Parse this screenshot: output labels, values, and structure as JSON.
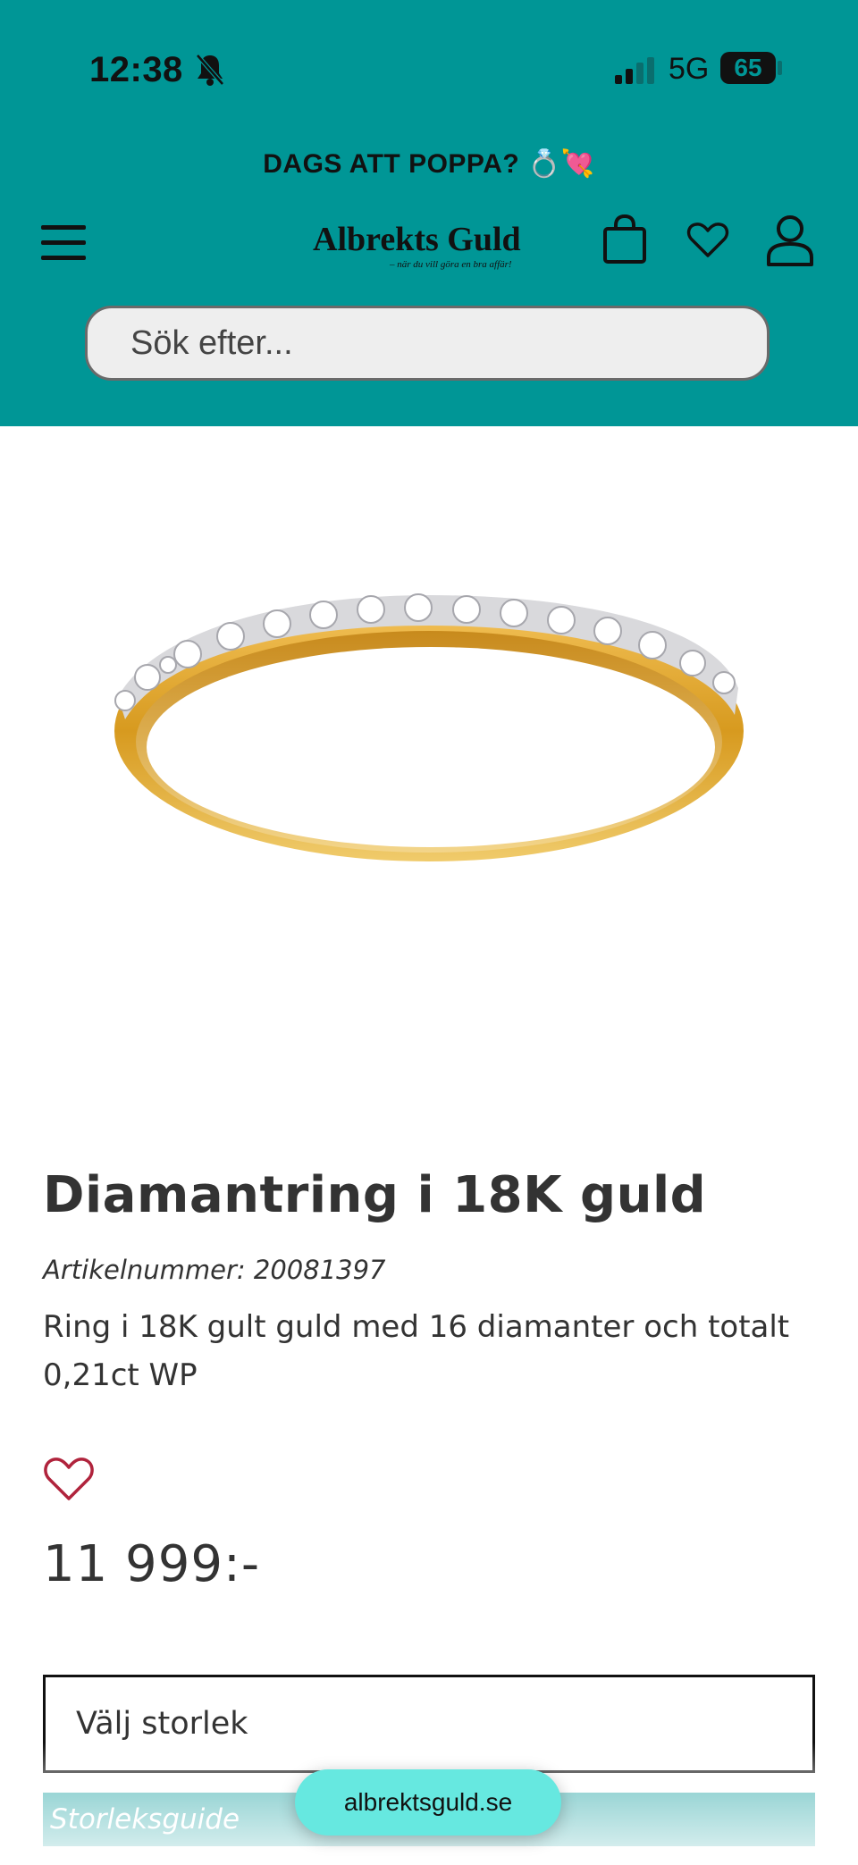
{
  "status_bar": {
    "time": "12:38",
    "network": "5G",
    "battery": "65",
    "icons": [
      "bell-slash-icon",
      "signal-icon",
      "battery-icon"
    ]
  },
  "header": {
    "promo_text": "DAGS ATT POPPA? 💍💘",
    "logo_text": "Albrekts Guld",
    "logo_tagline": "– när du vill göra en bra affär!",
    "icons": [
      "menu-icon",
      "logo",
      "shopping-bag-icon",
      "heart-icon",
      "user-icon"
    ],
    "background_color": "#009696"
  },
  "search": {
    "placeholder": "Sök efter..."
  },
  "product": {
    "title": "Diamantring i 18K guld",
    "article_number": "Artikelnummer: 20081397",
    "description": "Ring i 18K gult guld med 16 diamanter och totalt 0,21ct WP",
    "price": "11 999:-",
    "size_select_label": "Välj storlek",
    "size_guide_label": "Storleksguide"
  },
  "browser": {
    "url": "albrektsguld.se"
  }
}
